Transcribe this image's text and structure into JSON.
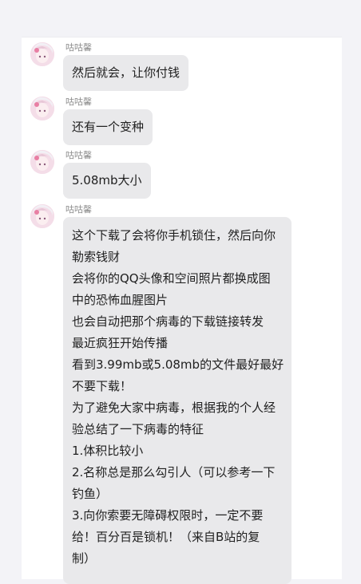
{
  "chat": {
    "sender": "咕咕馨",
    "messages": [
      {
        "text": "然后就会，让你付钱"
      },
      {
        "text": "还有一个变种"
      },
      {
        "text": "5.08mb大小"
      },
      {
        "lines": [
          "这个下载了会将你手机锁住，然后向你",
          "勒索钱财",
          "会将你的QQ头像和空间照片都换成图",
          "中的恐怖血腥图片",
          "也会自动把那个病毒的下载链接转发",
          "最近疯狂开始传播",
          "看到3.99mb或5.08mb的文件最好最好",
          "不要下载！",
          "为了避免大家中病毒，根据我的个人经",
          "验总结了一下病毒的特征",
          "1.体积比较小",
          "2.名称总是那么勾引人（可以参考一下",
          "钓鱼）",
          "3.向你索要无障碍权限时，一定不要",
          "给！百分百是锁机！（来自B站的复",
          "制）"
        ]
      }
    ]
  }
}
